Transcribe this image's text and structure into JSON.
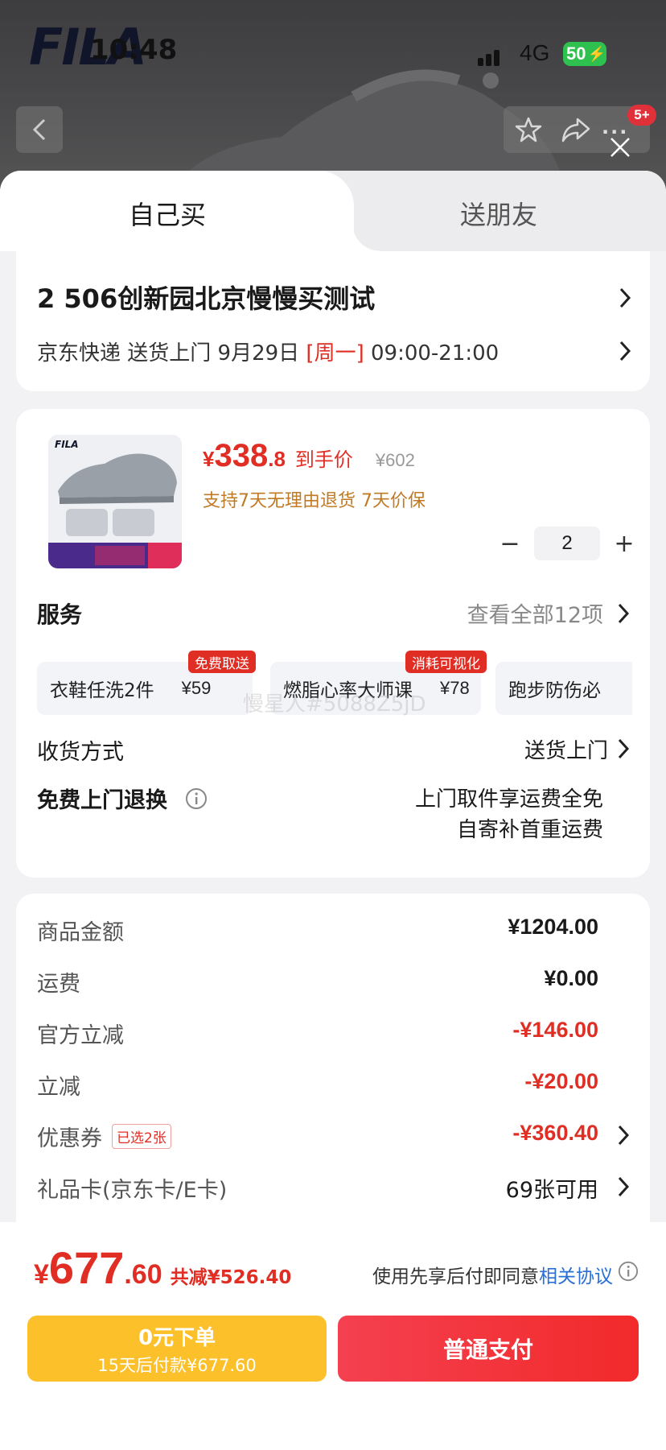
{
  "status_bar": {
    "time": "10:48",
    "network": "4G",
    "battery": "50"
  },
  "header": {
    "brand": "FILA",
    "message_badge": "5+"
  },
  "tabs": [
    {
      "label": "自己买",
      "active": true
    },
    {
      "label": "送朋友",
      "active": false
    }
  ],
  "address": {
    "line": "2  506创新园北京慢慢买测试",
    "delivery_prefix": "京东快递 送货上门 9月29日 ",
    "weekday": "[周一]",
    "time_window": " 09:00-21:00"
  },
  "product": {
    "price_symbol": "¥",
    "price_int": "338",
    "price_dec": ".8",
    "price_tag": "到手价",
    "original_price": "¥602",
    "guarantee": "支持7天无理由退货  7天价保",
    "quantity": "2",
    "qty_minus": "−",
    "qty_plus": "+"
  },
  "services": {
    "title": "服务",
    "more": "查看全部12项",
    "items": [
      {
        "name": "衣鞋任洗2件",
        "price": "¥59",
        "badge": "免费取送"
      },
      {
        "name": "燃脂心率大师课",
        "price": "¥78",
        "badge": "消耗可视化"
      },
      {
        "name": "跑步防伤必",
        "price": "",
        "badge": ""
      }
    ],
    "watermark": "慢星人#5088Z5jD"
  },
  "shipping": {
    "label": "收货方式",
    "value": "送货上门"
  },
  "free_return": {
    "label": "免费上门退换",
    "line1": "上门取件享运费全免",
    "line2": "自寄补首重运费"
  },
  "summary": {
    "goods_label": "商品金额",
    "goods_value": "¥1204.00",
    "freight_label": "运费",
    "freight_value": "¥0.00",
    "official_label": "官方立减",
    "official_value": "-¥146.00",
    "instant_label": "立减",
    "instant_value": "-¥20.00",
    "coupon_label": "优惠券",
    "coupon_tag": "已选2张",
    "coupon_value": "-¥360.40",
    "giftcard_label": "礼品卡(京东卡/E卡)",
    "giftcard_value": "69张可用"
  },
  "footer": {
    "total_symbol": "¥",
    "total_int": "677",
    "total_dec": ".60",
    "total_save": "共减¥526.40",
    "agree_text": "使用先享后付即同意",
    "agree_link": "相关协议",
    "later_line1": "0元下单",
    "later_line2": "15天后付款¥677.60",
    "pay_label": "普通支付"
  },
  "colors": {
    "accent_red": "#e02e24",
    "later_yellow": "#fcc02a",
    "link_blue": "#2a6fd6",
    "guarantee_gold": "#c07a25"
  }
}
